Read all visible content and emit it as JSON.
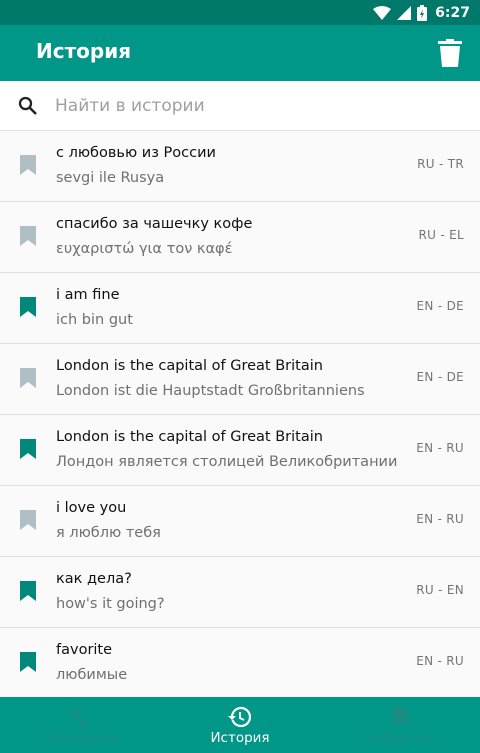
{
  "status_bar": {
    "time": "6:27"
  },
  "app_bar": {
    "title": "История"
  },
  "search": {
    "placeholder": "Найти в истории"
  },
  "colors": {
    "primary": "#009688",
    "status": "#00796b",
    "bookmark_active": "#00897b",
    "bookmark_inactive": "#b0bec5"
  },
  "history": [
    {
      "source": "с любовью из России",
      "translation": "sevgi ile Rusya",
      "langs": "RU - TR",
      "favorite": false
    },
    {
      "source": "спасибо за чашечку кофе",
      "translation": "ευχαριστώ για τον καφέ",
      "langs": "RU - EL",
      "favorite": false
    },
    {
      "source": "i am fine",
      "translation": "ich bin gut",
      "langs": "EN - DE",
      "favorite": true
    },
    {
      "source": "London is the capital of Great Britain",
      "translation": "London ist die Hauptstadt Großbritanniens",
      "langs": "EN - DE",
      "favorite": false
    },
    {
      "source": "London is the capital of Great Britain",
      "translation": "Лондон является столицей Великобритании",
      "langs": "EN - RU",
      "favorite": true
    },
    {
      "source": "i love you",
      "translation": "я люблю тебя",
      "langs": "EN - RU",
      "favorite": false
    },
    {
      "source": "как дела?",
      "translation": "how's it going?",
      "langs": "RU - EN",
      "favorite": true
    },
    {
      "source": "favorite",
      "translation": "любимые",
      "langs": "EN - RU",
      "favorite": true
    }
  ],
  "bottom_nav": [
    {
      "label": "Переводчик",
      "icon": "translate-icon",
      "active": false
    },
    {
      "label": "История",
      "icon": "history-icon",
      "active": true
    },
    {
      "label": "Избранное",
      "icon": "bookmark-icon",
      "active": false
    }
  ]
}
